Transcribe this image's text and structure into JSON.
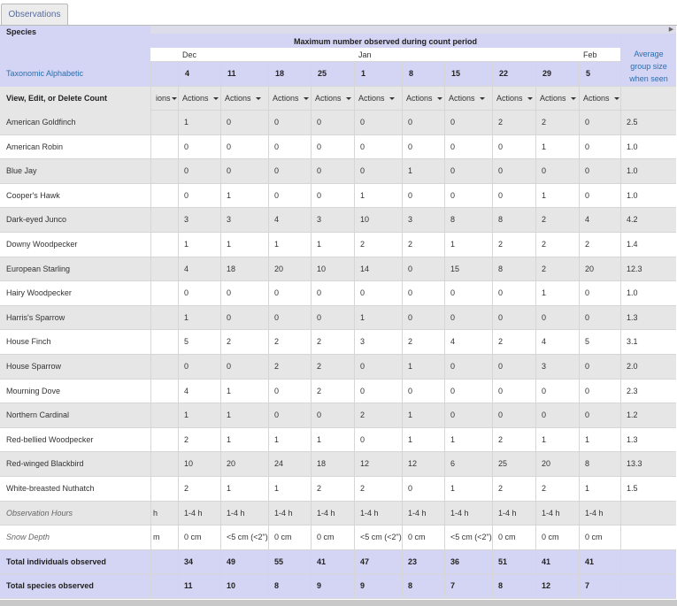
{
  "tab_label": "Observations",
  "left": {
    "species_header": "Species",
    "sort_link": "Taxonomic Alphabetic",
    "actions_header": "View, Edit, or Delete Count",
    "obs_hours_label": "Observation Hours",
    "snow_label": "Snow Depth",
    "total_individuals_label": "Total individuals observed",
    "total_species_label": "Total species observed"
  },
  "header": {
    "max_title": "Maximum number observed during count period",
    "average_title": "Average group size when seen",
    "months": [
      "Dec",
      "Jan",
      "Feb"
    ],
    "dates": [
      "4",
      "11",
      "18",
      "25",
      "1",
      "8",
      "15",
      "22",
      "29",
      "5"
    ],
    "partial_actions": "ions",
    "actions_label": "Actions"
  },
  "species": [
    {
      "name": "American Goldfinch",
      "counts": [
        "1",
        "0",
        "0",
        "0",
        "0",
        "0",
        "0",
        "2",
        "2",
        "0"
      ],
      "avg": "2.5"
    },
    {
      "name": "American Robin",
      "counts": [
        "0",
        "0",
        "0",
        "0",
        "0",
        "0",
        "0",
        "0",
        "1",
        "0"
      ],
      "avg": "1.0"
    },
    {
      "name": "Blue Jay",
      "counts": [
        "0",
        "0",
        "0",
        "0",
        "0",
        "1",
        "0",
        "0",
        "0",
        "0"
      ],
      "avg": "1.0"
    },
    {
      "name": "Cooper's Hawk",
      "counts": [
        "0",
        "1",
        "0",
        "0",
        "1",
        "0",
        "0",
        "0",
        "1",
        "0"
      ],
      "avg": "1.0"
    },
    {
      "name": "Dark-eyed Junco",
      "counts": [
        "3",
        "3",
        "4",
        "3",
        "10",
        "3",
        "8",
        "8",
        "2",
        "4"
      ],
      "avg": "4.2"
    },
    {
      "name": "Downy Woodpecker",
      "counts": [
        "1",
        "1",
        "1",
        "1",
        "2",
        "2",
        "1",
        "2",
        "2",
        "2"
      ],
      "avg": "1.4"
    },
    {
      "name": "European Starling",
      "counts": [
        "4",
        "18",
        "20",
        "10",
        "14",
        "0",
        "15",
        "8",
        "2",
        "20"
      ],
      "avg": "12.3"
    },
    {
      "name": "Hairy Woodpecker",
      "counts": [
        "0",
        "0",
        "0",
        "0",
        "0",
        "0",
        "0",
        "0",
        "1",
        "0"
      ],
      "avg": "1.0"
    },
    {
      "name": "Harris's Sparrow",
      "counts": [
        "1",
        "0",
        "0",
        "0",
        "1",
        "0",
        "0",
        "0",
        "0",
        "0"
      ],
      "avg": "1.3"
    },
    {
      "name": "House Finch",
      "counts": [
        "5",
        "2",
        "2",
        "2",
        "3",
        "2",
        "4",
        "2",
        "4",
        "5"
      ],
      "avg": "3.1"
    },
    {
      "name": "House Sparrow",
      "counts": [
        "0",
        "0",
        "2",
        "2",
        "0",
        "1",
        "0",
        "0",
        "3",
        "0"
      ],
      "avg": "2.0"
    },
    {
      "name": "Mourning Dove",
      "counts": [
        "4",
        "1",
        "0",
        "2",
        "0",
        "0",
        "0",
        "0",
        "0",
        "0"
      ],
      "avg": "2.3"
    },
    {
      "name": "Northern Cardinal",
      "counts": [
        "1",
        "1",
        "0",
        "0",
        "2",
        "1",
        "0",
        "0",
        "0",
        "0"
      ],
      "avg": "1.2"
    },
    {
      "name": "Red-bellied Woodpecker",
      "counts": [
        "2",
        "1",
        "1",
        "1",
        "0",
        "1",
        "1",
        "2",
        "1",
        "1"
      ],
      "avg": "1.3"
    },
    {
      "name": "Red-winged Blackbird",
      "counts": [
        "10",
        "20",
        "24",
        "18",
        "12",
        "12",
        "6",
        "25",
        "20",
        "8"
      ],
      "avg": "13.3"
    },
    {
      "name": "White-breasted Nuthatch",
      "counts": [
        "2",
        "1",
        "1",
        "2",
        "2",
        "0",
        "1",
        "2",
        "2",
        "1"
      ],
      "avg": "1.5"
    }
  ],
  "obs_hours": {
    "partial": "h",
    "values": [
      "1-4 h",
      "1-4 h",
      "1-4 h",
      "1-4 h",
      "1-4 h",
      "1-4 h",
      "1-4 h",
      "1-4 h",
      "1-4 h",
      "1-4 h"
    ]
  },
  "snow_depth": {
    "partial": "m",
    "values": [
      "0 cm",
      "<5 cm (<2\")",
      "0 cm",
      "0 cm",
      "<5 cm (<2\")",
      "0 cm",
      "<5 cm (<2\")",
      "0 cm",
      "0 cm",
      "0 cm"
    ]
  },
  "total_individuals": [
    "34",
    "49",
    "55",
    "41",
    "47",
    "23",
    "36",
    "51",
    "41",
    "41"
  ],
  "total_species": [
    "11",
    "10",
    "8",
    "9",
    "9",
    "8",
    "7",
    "8",
    "12",
    "7"
  ],
  "colors": {
    "header_lavender": "#d4d4f4",
    "row_grey": "#e6e6e6",
    "link_blue": "#2a6fb0"
  }
}
